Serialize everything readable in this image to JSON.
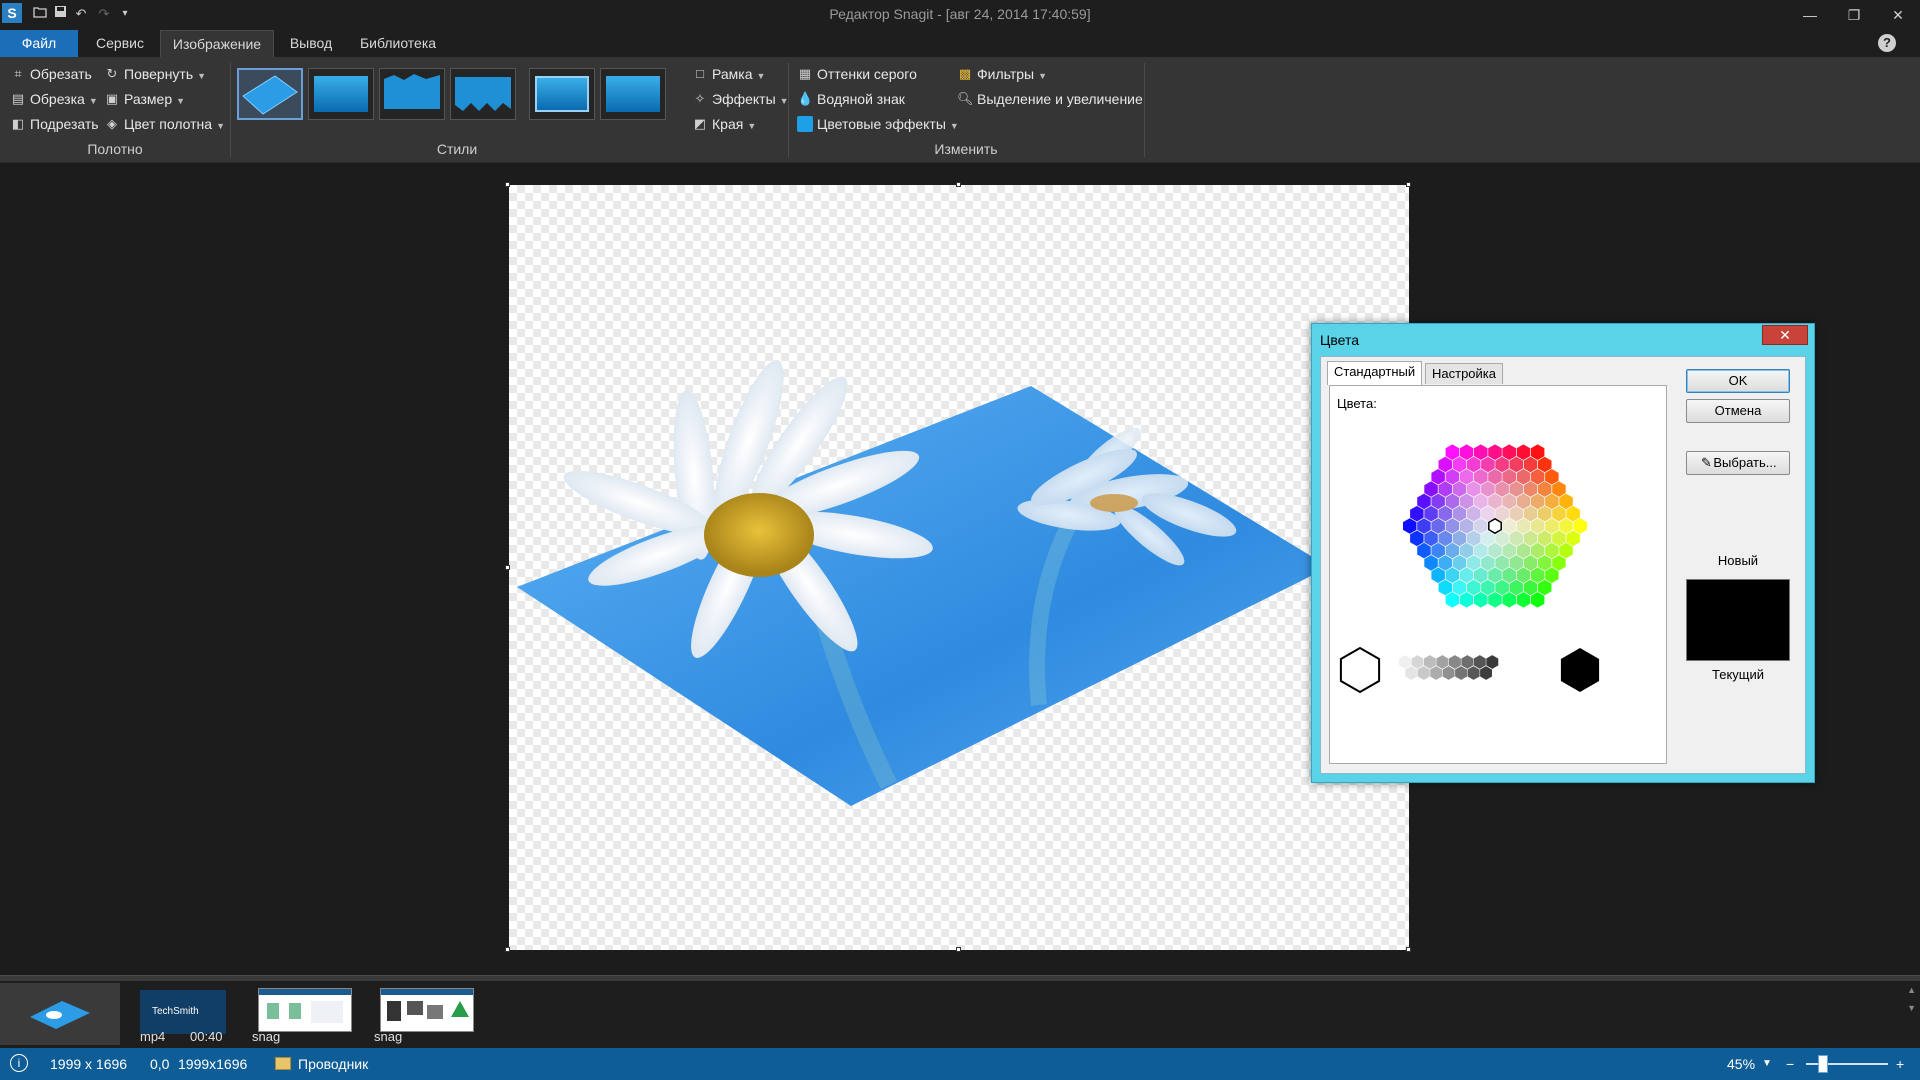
{
  "window": {
    "title": "Редактор Snagit - [авг 24, 2014 17:40:59]",
    "app_icon": "S"
  },
  "quick_access": [
    "open-icon",
    "save-icon",
    "undo-icon",
    "redo-icon",
    "customize-icon"
  ],
  "tabs": [
    {
      "label": "Файл"
    },
    {
      "label": "Сервис"
    },
    {
      "label": "Изображение"
    },
    {
      "label": "Вывод"
    },
    {
      "label": "Библиотека"
    }
  ],
  "ribbon": {
    "canvas_group": {
      "label": "Полотно",
      "crop": "Обрезать",
      "rotate": "Повернуть",
      "cutout": "Обрезка",
      "resize": "Размер",
      "trim": "Подрезать",
      "canvas_color": "Цвет полотна"
    },
    "styles_group": {
      "label": "Стили"
    },
    "effects_group": {
      "border": "Рамка",
      "effects": "Эффекты",
      "edges": "Края"
    },
    "modify_group": {
      "label": "Изменить",
      "grayscale": "Оттенки серого",
      "watermark": "Водяной знак",
      "color_effects": "Цветовые эффекты",
      "filters": "Фильтры",
      "spotlight": "Выделение и увеличение"
    }
  },
  "dialog": {
    "title": "Цвета",
    "close_symbol": "✕",
    "tab_standard": "Стандартный",
    "tab_custom": "Настройка",
    "colors_label": "Цвета:",
    "ok": "OK",
    "cancel": "Отмена",
    "pick": "Выбрать...",
    "new_label": "Новый",
    "current_label": "Текущий",
    "new_color": "#000000"
  },
  "tray": {
    "items": [
      {
        "caption": ""
      },
      {
        "caption": "mp4",
        "duration": "00:40",
        "brand": "TechSmith"
      },
      {
        "caption": "snag"
      },
      {
        "caption": "snag"
      }
    ]
  },
  "status": {
    "image_size": "1999 x 1696",
    "position": "0,0",
    "selection_size": "1999x1696",
    "explorer": "Проводник",
    "zoom": "45%"
  },
  "colors": {
    "accent": "#1b6fb8",
    "status_bar": "#0f5d97",
    "ribbon_bg": "#353535",
    "dialog_frame": "#5ad2e8"
  }
}
